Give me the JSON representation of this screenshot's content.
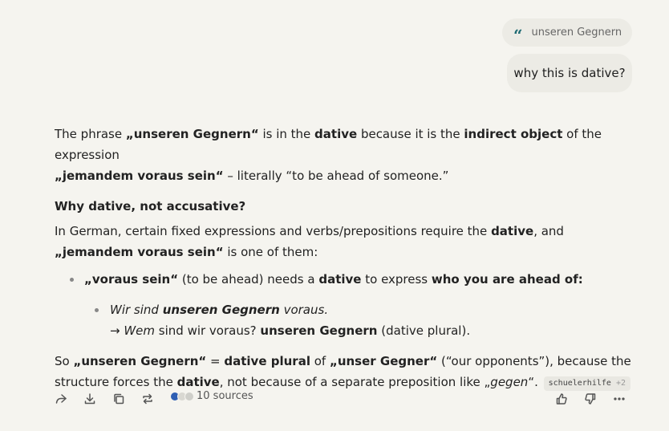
{
  "quote": {
    "icon": "quote-icon",
    "text": "unseren Gegnern"
  },
  "user_message": "why this is dative?",
  "answer": {
    "p1": [
      "The phrase ",
      "„unseren Gegnern“",
      " is in the ",
      "dative",
      " because it is the ",
      "indirect object",
      " of the expression ",
      "„jemandem voraus sein“",
      " – literally “to be ahead of someone.”"
    ],
    "heading": "Why dative, not accusative?",
    "p2": [
      "In German, certain fixed expressions and verbs/prepositions require the ",
      "dative",
      ", and ",
      "„jemandem voraus sein“",
      " is one of them:"
    ],
    "bullet1": [
      "„voraus sein“",
      " (to be ahead) needs a ",
      "dative",
      " to express ",
      "who you are ahead of",
      ":"
    ],
    "bullet2_line1": [
      "Wir sind ",
      "unseren Gegnern",
      " voraus."
    ],
    "bullet2_line2": [
      "→ ",
      "Wem",
      " sind wir voraus? ",
      "unseren Gegnern",
      " (dative plural)."
    ],
    "p3": [
      "So ",
      "„unseren Gegnern“",
      " = ",
      "dative plural",
      " of ",
      "„unser Gegner“",
      " (“our opponents”), because the structure forces the ",
      "dative",
      ", not because of a separate preposition like ",
      "„",
      "gegen",
      "“."
    ],
    "citation": {
      "label": "schuelerhilfe",
      "more": "+2"
    }
  },
  "actions": {
    "share": "share-icon",
    "download": "download-icon",
    "copy": "copy-icon",
    "rewrite": "rewrite-icon",
    "sources_label": "10 sources",
    "like": "thumbs-up-icon",
    "dislike": "thumbs-down-icon",
    "more": "more-icon"
  }
}
